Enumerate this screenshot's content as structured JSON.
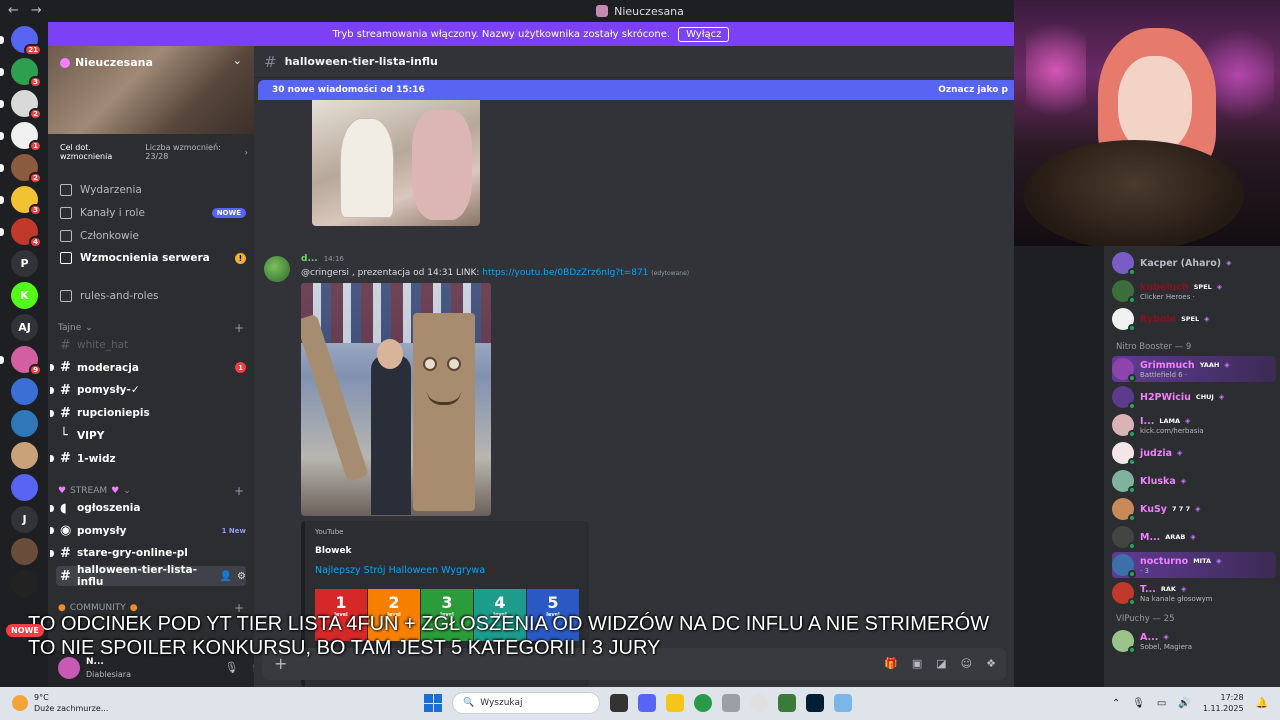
{
  "window": {
    "title": "Nieuczesana"
  },
  "notice": {
    "text": "Tryb streamowania włączony. Nazwy użytkownika zostały skrócone.",
    "button": "Wyłącz"
  },
  "servers": [
    {
      "initial": "",
      "badge": "21",
      "color": "#5865f2"
    },
    {
      "initial": "",
      "badge": "3",
      "color": "#2e9e4f"
    },
    {
      "initial": "",
      "badge": "2",
      "color": "#d9d9d9"
    },
    {
      "initial": "",
      "badge": "1",
      "color": "#f0f0f0"
    },
    {
      "initial": "",
      "badge": "2",
      "color": "#8c5a3c"
    },
    {
      "initial": "",
      "badge": "3",
      "color": "#f1c232"
    },
    {
      "initial": "",
      "badge": "4",
      "color": "#c0392b"
    },
    {
      "initial": "P",
      "badge": "",
      "color": "#1e1f22"
    },
    {
      "initial": "K",
      "badge": "",
      "color": "#53fc18"
    },
    {
      "initial": "AJ",
      "badge": "",
      "color": "#1e1f22"
    },
    {
      "initial": "",
      "badge": "9",
      "color": "#d35fa0"
    },
    {
      "initial": "",
      "badge": "",
      "color": "#3b6fd6"
    },
    {
      "initial": "",
      "badge": "",
      "color": "#2f77b8"
    },
    {
      "initial": "",
      "badge": "",
      "color": "#c9a27a"
    },
    {
      "initial": "",
      "badge": "",
      "color": "#5865f2"
    },
    {
      "initial": "J",
      "badge": "",
      "color": "#1e1f22"
    },
    {
      "initial": "",
      "badge": "",
      "color": "#6a4c3a"
    },
    {
      "initial": "",
      "badge": "",
      "color": "#222"
    }
  ],
  "server": {
    "name": "Nieuczesana",
    "boost_goal": "Cel dot. wzmocnienia",
    "boost_count_label": "Liczba wzmocnień: 23/28",
    "nav": [
      {
        "label": "Wydarzenia"
      },
      {
        "label": "Kanały i role",
        "tag": "NOWE"
      },
      {
        "label": "Członkowie"
      },
      {
        "label": "Wzmocnienia serwera",
        "warn": "!"
      }
    ],
    "rules": "rules-and-roles",
    "cat_secret": "Tajne",
    "secret_channels": [
      {
        "name": "white_hat",
        "mention": ""
      },
      {
        "name": "moderacja",
        "mention": "1"
      },
      {
        "name": "pomysły-✓",
        "mention": ""
      },
      {
        "name": "rupcioniepis",
        "mention": ""
      },
      {
        "name": "VIPY",
        "mention": ""
      },
      {
        "name": "1-widz",
        "mention": ""
      }
    ],
    "cat_stream": "STREAM",
    "stream_channels": [
      {
        "name": "ogłoszenia",
        "extra": ""
      },
      {
        "name": "pomysły",
        "extra": "1 New"
      },
      {
        "name": "stare-gry-online-pl",
        "extra": ""
      },
      {
        "name": "halloween-tier-lista-influ",
        "extra": ""
      }
    ],
    "cat_community": "COMMUNITY"
  },
  "user": {
    "name": "N...",
    "status": "Diablesiara"
  },
  "channel": {
    "name": "halloween-tier-lista-influ",
    "new_msgs": "30 nowe wiadomości od 15:16",
    "mark_read": "Oznacz jako p"
  },
  "message": {
    "author": "d...",
    "time": "14:16",
    "text": "@cringersi , prezentacja od 14:31  LINK: ",
    "link": "https://youtu.be/0BDzZrz6nIg?t=871",
    "edited": "(edytowane)"
  },
  "embed": {
    "provider": "YouTube",
    "author": "Blowek",
    "title": "Najlepszy Strój Halloween Wygrywa",
    "tiers": [
      {
        "num": "1",
        "sub": "level",
        "color": "#d62828"
      },
      {
        "num": "2",
        "sub": "level",
        "color": "#f77f00"
      },
      {
        "num": "3",
        "sub": "level",
        "color": "#2a9d3a"
      },
      {
        "num": "4",
        "sub": "level",
        "color": "#1c9c8a"
      },
      {
        "num": "5",
        "sub": "level",
        "color": "#2b59c3"
      }
    ]
  },
  "members": {
    "top": [
      {
        "name": "Kacper (Aharo)",
        "sub": "",
        "tag": "",
        "color": "#b5bac1",
        "av": "#7a5cc7",
        "boosted": false
      },
      {
        "name": "kubeluch",
        "sub": "Clicker Heroes · ",
        "tag": "SPEL",
        "color": "#8a0f1f",
        "av": "#3b6e3b",
        "boosted": false
      },
      {
        "name": "Rybole",
        "sub": "",
        "tag": "SPEL",
        "color": "#8a0f1f",
        "av": "#f0f0f0",
        "boosted": false
      }
    ],
    "nitro_header": "Nitro Booster — 9",
    "nitro": [
      {
        "name": "Grimmuch",
        "sub": "Battlefield 6 · ",
        "tag": "YAAH",
        "color": "#f47fff",
        "av": "#8e44ad",
        "boosted": true
      },
      {
        "name": "H2PWiciu",
        "sub": "",
        "tag": "CHUJ",
        "color": "#f47fff",
        "av": "#5c3a8c",
        "boosted": false
      },
      {
        "name": "I...",
        "sub": "kick.com/herbasia",
        "tag": "LAMA",
        "color": "#f47fff",
        "av": "#d8b4b4",
        "boosted": false
      },
      {
        "name": "judzia",
        "sub": "",
        "tag": "",
        "color": "#f47fff",
        "av": "#f2e6e6",
        "boosted": false
      },
      {
        "name": "Kluska",
        "sub": "",
        "tag": "",
        "color": "#f47fff",
        "av": "#7fb3a0",
        "boosted": false
      },
      {
        "name": "KuSy",
        "sub": "",
        "tag": "7 7 7",
        "color": "#f47fff",
        "av": "#c98a5a",
        "boosted": false
      },
      {
        "name": "M...",
        "sub": "",
        "tag": "ARAB",
        "color": "#f47fff",
        "av": "#444",
        "boosted": false
      },
      {
        "name": "nocturno",
        "sub": "· 3",
        "tag": "MITA",
        "color": "#f47fff",
        "av": "#3d6fa8",
        "boosted": true
      },
      {
        "name": "T...",
        "sub": "Na kanale głosowym",
        "tag": "RAK",
        "color": "#f47fff",
        "av": "#c0392b",
        "boosted": false
      }
    ],
    "vip_header": "VIPuchy — 25",
    "vip": [
      {
        "name": "A...",
        "sub": "Sobel, Magiera",
        "tag": "",
        "color": "#f47fff",
        "av": "#9bc48a",
        "boosted": false
      }
    ]
  },
  "subtitles": [
    "TO ODCINEK POD YT TIER LISTA 4FUN + ZGŁOSZENIA OD WIDZÓW NA DC INFLU A NIE STRIMERÓW",
    "TO NIE SPOILER KONKURSU, BO TAM JEST 5 KATEGORII I 3 JURY"
  ],
  "nowe_badge": "NOWE",
  "taskbar": {
    "temp": "9°C",
    "weather": "Duże zachmurze...",
    "search": "Wyszukaj",
    "time": "17:28",
    "date": "1.11.2025"
  }
}
